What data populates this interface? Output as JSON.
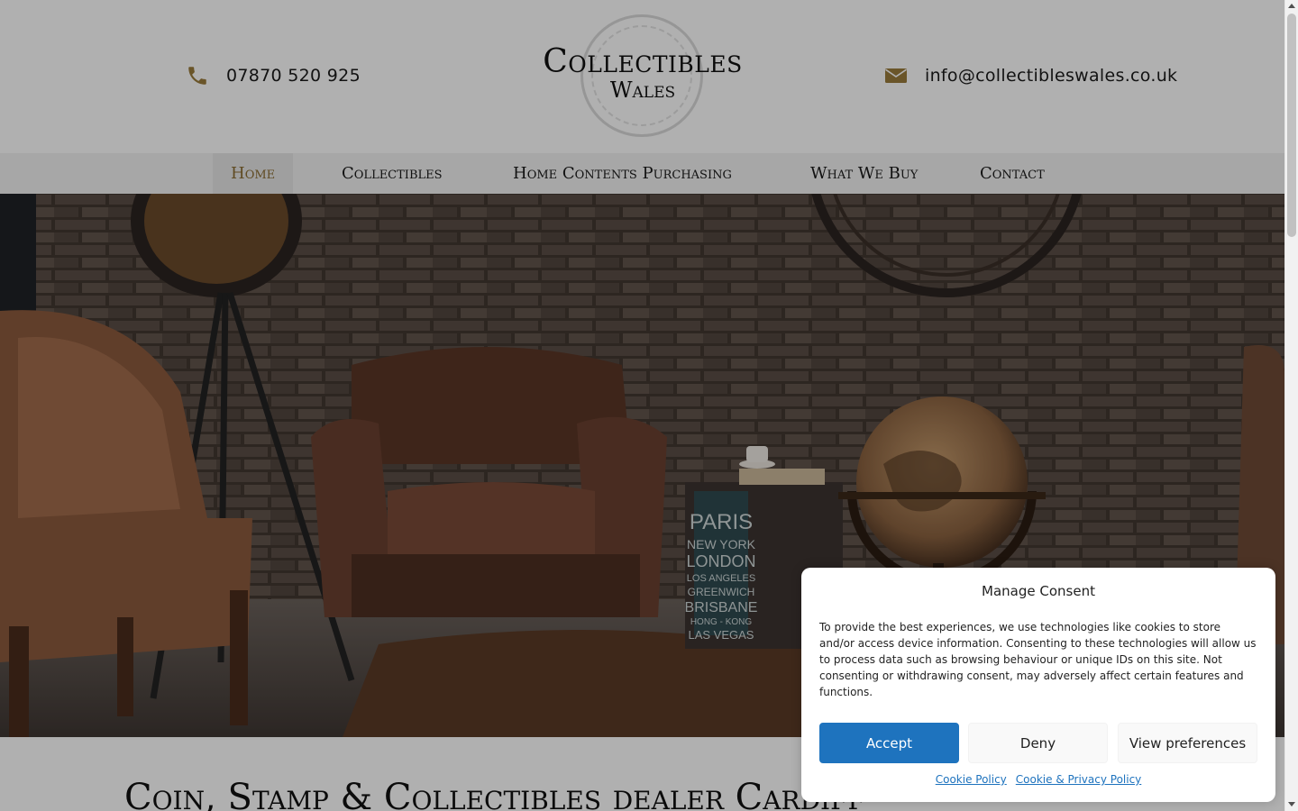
{
  "header": {
    "phone": "07870 520 925",
    "email": "info@collectibleswales.co.uk",
    "logo_line1": "Collectibles",
    "logo_line2": "Wales",
    "icon_color": "#9a7b3c"
  },
  "nav": {
    "items": [
      {
        "label": "Home",
        "active": true
      },
      {
        "label": "Collectibles"
      },
      {
        "label": "Home Contents Purchasing"
      },
      {
        "label": "What We Buy"
      },
      {
        "label": "Contact"
      }
    ],
    "active_color": "#8b6d33"
  },
  "hero": {
    "image": "vintage-interior-photo",
    "crate_text": [
      "PARIS",
      "NEW YORK",
      "LONDON",
      "LOS ANGELES",
      "GREENWICH",
      "BRISBANE",
      "HONG - KONG",
      "LAS VEGAS"
    ]
  },
  "section": {
    "heading": "Coin, Stamp & Collectibles dealer Cardiff"
  },
  "consent": {
    "title": "Manage Consent",
    "body": "To provide the best experiences, we use technologies like cookies to store and/or access device information. Consenting to these technologies will allow us to process data such as browsing behaviour or unique IDs on this site. Not consenting or withdrawing consent, may adversely affect certain features and functions.",
    "accept_label": "Accept",
    "deny_label": "Deny",
    "prefs_label": "View preferences",
    "link1": "Cookie Policy",
    "link2": "Cookie & Privacy Policy",
    "accent_color": "#1e73be"
  }
}
